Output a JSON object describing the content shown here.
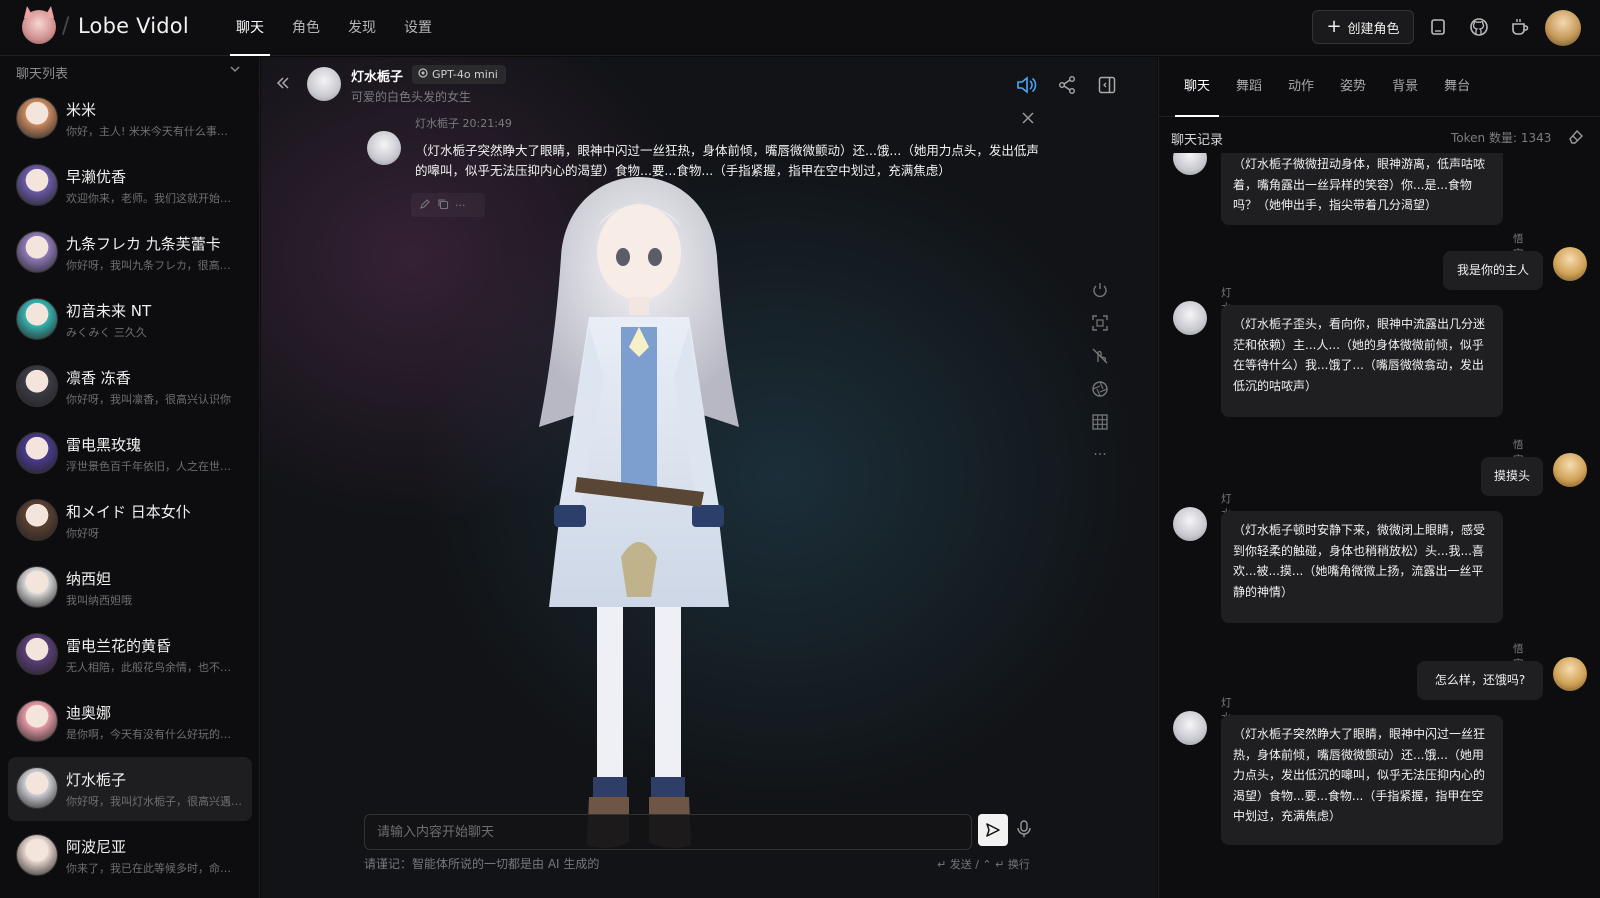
{
  "app": {
    "title": "Lobe Vidol"
  },
  "nav": {
    "items": [
      "聊天",
      "角色",
      "发现",
      "设置"
    ],
    "active_index": 0
  },
  "topbar": {
    "create_label": "创建角色",
    "icons": [
      "book-icon",
      "github-icon",
      "coffee-icon"
    ]
  },
  "sidebar": {
    "header": "聊天列表",
    "items": [
      {
        "name": "米米",
        "preview": "你好，主人! 米米今天有什么事…",
        "color": "#c98a5f"
      },
      {
        "name": "早濑优香",
        "preview": "欢迎你来，老师。我们这就开始…",
        "color": "#6b5aa8"
      },
      {
        "name": "九条フレカ 九条芙蕾卡",
        "preview": "你好呀，我叫九条フレカ，很高…",
        "color": "#8f7ab8"
      },
      {
        "name": "初音未来 NT",
        "preview": "みくみく 三久久",
        "color": "#37b3b0"
      },
      {
        "name": "凛香 冻香",
        "preview": "你好呀，我叫凛香，很高兴认识你",
        "color": "#3b3b46"
      },
      {
        "name": "雷电黑玫瑰",
        "preview": "浮世景色百千年依旧，人之在世…",
        "color": "#4a3a8c"
      },
      {
        "name": "和メイド 日本女仆",
        "preview": "你好呀",
        "color": "#5a4030"
      },
      {
        "name": "纳西妲",
        "preview": "我叫纳西妲哦",
        "color": "#d9d9d9"
      },
      {
        "name": "雷电兰花的黄昏",
        "preview": "无人相陪，此般花鸟余情，也不…",
        "color": "#5a3e78"
      },
      {
        "name": "迪奥娜",
        "preview": "是你啊，今天有没有什么好玩的…",
        "color": "#e59aa6"
      },
      {
        "name": "灯水栀子",
        "preview": "你好呀，我叫灯水栀子，很高兴遇…",
        "color": "#cfcfd6"
      },
      {
        "name": "阿波尼亚",
        "preview": "你来了，我已在此等候多时，命…",
        "color": "#e8d6cf"
      }
    ],
    "active_index": 10
  },
  "chat": {
    "name": "灯水栀子",
    "model": "GPT-4o mini",
    "description": "可爱的白色头发的女生",
    "bubble": {
      "meta": "灯水栀子 20:21:49",
      "text": "（灯水栀子突然睁大了眼睛，眼神中闪过一丝狂热，身体前倾，嘴唇微微颤动）还...饿...（她用力点头，发出低声的嗥叫，似乎无法压抑内心的渴望）食物...要...食物...（手指紧握，指甲在空中划过，充满焦虑）"
    },
    "input_placeholder": "请输入内容开始聊天",
    "disclaimer": "请谨记：智能体所说的一切都是由 AI 生成的",
    "shortcut": "↵ 发送 / ⌃ ↵ 换行"
  },
  "rpanel": {
    "tabs": [
      "聊天",
      "舞蹈",
      "动作",
      "姿势",
      "背景",
      "舞台"
    ],
    "active_index": 0,
    "history_label": "聊天记录",
    "token_label": "Token 数量: 1343",
    "messages": [
      {
        "role": "bot",
        "name": "",
        "text": "（灯水栀子微微扭动身体，眼神游离，低声咕哝着，嘴角露出一丝异样的笑容）你...是...食物吗？（她伸出手，指尖带着几分渴望）"
      },
      {
        "role": "user",
        "name": "悟空",
        "text": "我是你的主人"
      },
      {
        "role": "bot",
        "name": "灯水栀子",
        "text": "（灯水栀子歪头，看向你，眼神中流露出几分迷茫和依赖）主...人...（她的身体微微前倾，似乎在等待什么）我...饿了...（嘴唇微微翕动，发出低沉的咕哝声）"
      },
      {
        "role": "user",
        "name": "悟空",
        "text": "摸摸头"
      },
      {
        "role": "bot",
        "name": "灯水栀子",
        "text": "（灯水栀子顿时安静下来，微微闭上眼睛，感受到你轻柔的触碰，身体也稍稍放松）头...我...喜欢...被...摸...（她嘴角微微上扬，流露出一丝平静的神情）"
      },
      {
        "role": "user",
        "name": "悟空",
        "text": "怎么样，还饿吗?"
      },
      {
        "role": "bot",
        "name": "灯水栀子",
        "text": "（灯水栀子突然睁大了眼睛，眼神中闪过一丝狂热，身体前倾，嘴唇微微颤动）还...饿...（她用力点头，发出低沉的嗥叫，似乎无法压抑内心的渴望）食物...要...食物...（手指紧握，指甲在空中划过，充满焦虑）"
      }
    ]
  }
}
